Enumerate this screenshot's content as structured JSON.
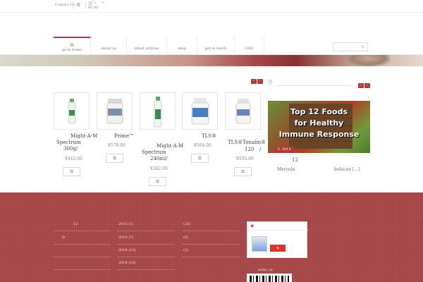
{
  "topbar": {
    "contact_label": "Contact Us",
    "cart_count": "0",
    "cart_total": "¥0.00"
  },
  "nav": {
    "items": [
      {
        "label": "go to home"
      },
      {
        "label": "about us"
      },
      {
        "label": "latest articles"
      },
      {
        "label": "shop"
      },
      {
        "label": "get in touch"
      },
      {
        "label": "FAQ"
      }
    ]
  },
  "products": [
    {
      "name_line1": "Might-A-M",
      "name_line2": "Spectrum",
      "name_line3": "300g/",
      "price": "¥442.00"
    },
    {
      "name_line1": "Prime™",
      "name_line2": "",
      "name_line3": "",
      "price": "¥578.00"
    },
    {
      "name_line1": "Might-A-M",
      "name_line2": "Spectrum",
      "name_line3": "240ml/",
      "price": "¥282.00"
    },
    {
      "name_line1": "TLS®",
      "name_line2": "",
      "name_line3": "",
      "price": "¥564.00"
    },
    {
      "name_line1": "TLS®Tonalin®",
      "name_line2": "120",
      "name_line3": "/",
      "price": "¥555.00"
    }
  ],
  "blog": {
    "image_title_line1": "Top 12 Foods",
    "image_title_line2": "for Healthy",
    "image_title_line3": "Immune Response",
    "date_badge": "3, 2015",
    "post_title": "12",
    "author": "Mercola",
    "source": "bolai.us",
    "more": "[…]"
  },
  "footer": {
    "col1": [
      "12",
      "D"
    ],
    "archive": [
      "2015 (1)",
      "2014 (7)",
      "2014 (13)",
      "2014 (10)"
    ],
    "counts": [
      "(23)",
      "(6)",
      "(2)"
    ],
    "follow_label": "+",
    "site_label": "bolai_us"
  },
  "colors": {
    "accent": "#b13a3a",
    "footer_bg": "#a54446"
  }
}
